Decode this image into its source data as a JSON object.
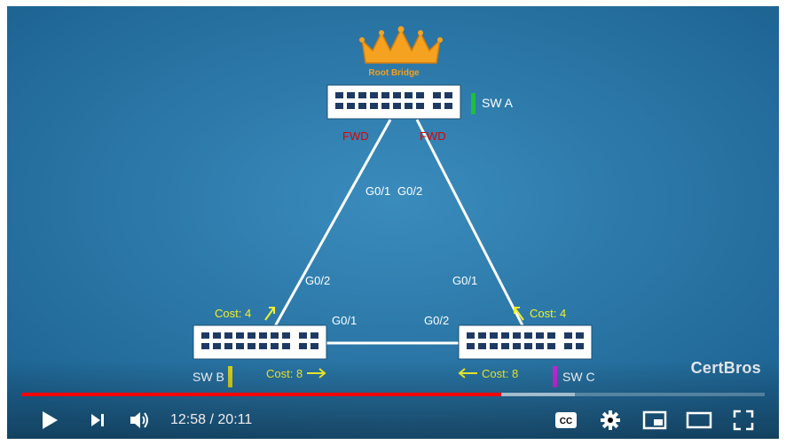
{
  "diagram": {
    "root_label": "Root Bridge",
    "switches": [
      {
        "name": "SW A",
        "marker_color": "#1fbf3a"
      },
      {
        "name": "SW B",
        "marker_color": "#d8d31a"
      },
      {
        "name": "SW C",
        "marker_color": "#c02ad6"
      }
    ],
    "links": [
      {
        "from": "SW A",
        "to": "SW B",
        "from_port": "G0/1",
        "to_port": "G0/2",
        "from_state": "FWD",
        "to_cost": "Cost: 4"
      },
      {
        "from": "SW A",
        "to": "SW C",
        "from_port": "G0/2",
        "to_port": "G0/1",
        "from_state": "FWD",
        "to_cost": "Cost: 4"
      },
      {
        "from": "SW B",
        "to": "SW C",
        "from_port": "G0/1",
        "to_port": "G0/2",
        "from_cost": "Cost: 8",
        "to_cost": "Cost: 8"
      }
    ],
    "watermark": "CertBros",
    "colors": {
      "background": "#2a77a8",
      "link": "#ffffff",
      "fwd": "#e00000",
      "cost": "#f3f02a",
      "crown": "#f3a020"
    }
  },
  "player": {
    "current_time": "12:58",
    "separator": " / ",
    "duration": "20:11",
    "progress_played": 0.646,
    "progress_buffered": 0.745,
    "buttons": {
      "play": "play-icon",
      "next": "next-icon",
      "volume": "volume-icon",
      "captions": "CC",
      "settings": "gear-icon",
      "miniplayer": "miniplayer-icon",
      "theater": "theater-icon",
      "fullscreen": "fullscreen-icon"
    }
  }
}
